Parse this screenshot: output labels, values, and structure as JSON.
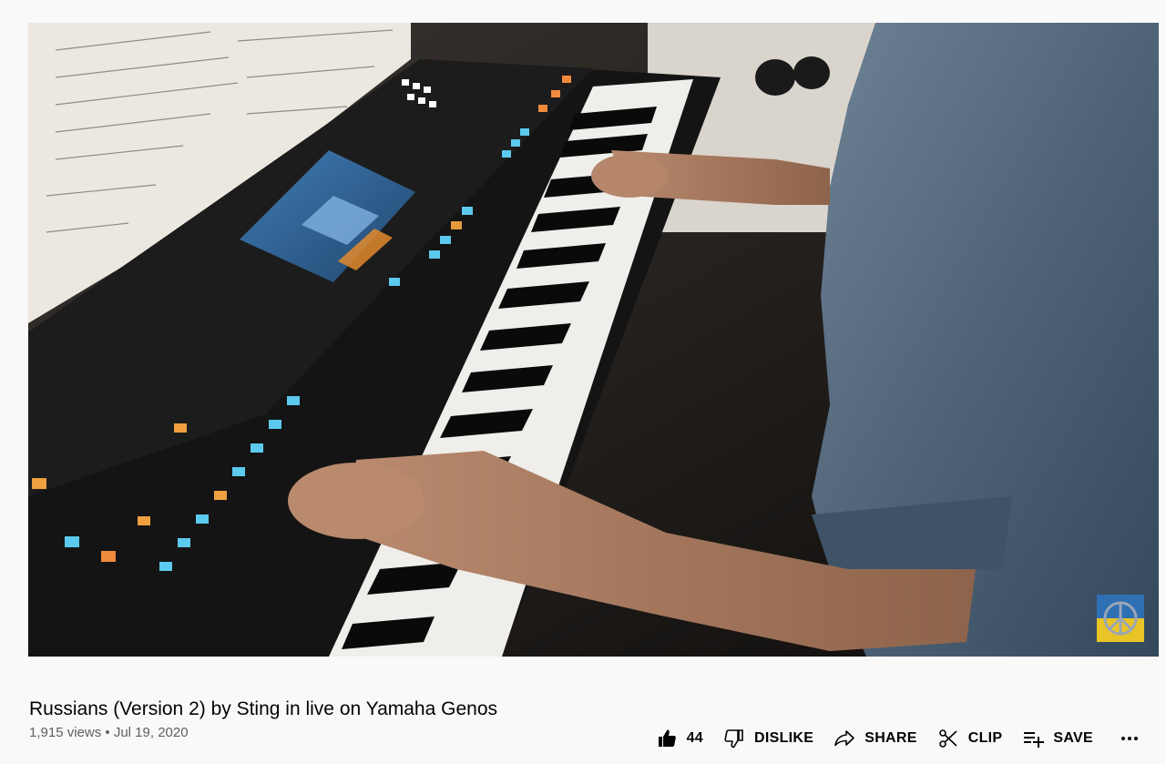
{
  "video": {
    "title": "Russians (Version 2) by Sting in live on Yamaha Genos",
    "views": "1,915 views",
    "separator": "•",
    "date": "Jul 19, 2020",
    "watermark_icon": "peace-symbol-icon"
  },
  "actions": {
    "like_count": "44",
    "dislike_label": "DISLIKE",
    "share_label": "SHARE",
    "clip_label": "CLIP",
    "save_label": "SAVE",
    "more_icon": "more-horizontal-icon"
  },
  "colors": {
    "page_background": "#f9f9f9",
    "text_primary": "#030303",
    "text_secondary": "#606060"
  }
}
